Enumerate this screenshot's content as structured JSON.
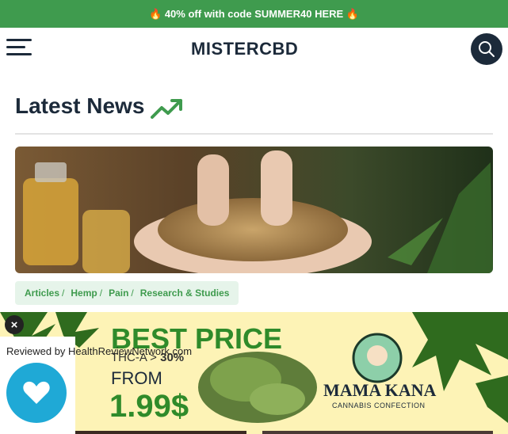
{
  "promo": {
    "text": "🔥 40% off with code SUMMER40 HERE 🔥"
  },
  "header": {
    "logo_text": "MISTERCBD",
    "menu_icon": "hamburger-icon",
    "search_icon": "search-icon"
  },
  "section": {
    "title": "Latest News",
    "icon": "trending-up-icon"
  },
  "article": {
    "image_alt": "hands holding hemp seeds",
    "categories": [
      "Articles",
      "Hemp",
      "Pain",
      "Research & Studies"
    ]
  },
  "ad": {
    "headline": "BEST PRICE",
    "product_prefix": "THC-A > ",
    "product_strength": "30%",
    "from_label": "FROM",
    "price": "1.99$",
    "brand": "MAMA KANA",
    "brand_sub": "CANNABIS CONFECTION"
  },
  "review_badge": {
    "text": "Reviewed by HealthReviewNetwork.com",
    "icon": "heart-icon"
  },
  "colors": {
    "brand_green": "#3f9b4e",
    "navy": "#1c2a3a",
    "ad_bg": "#fdf3b6",
    "badge_blue": "#1fa9d6"
  }
}
